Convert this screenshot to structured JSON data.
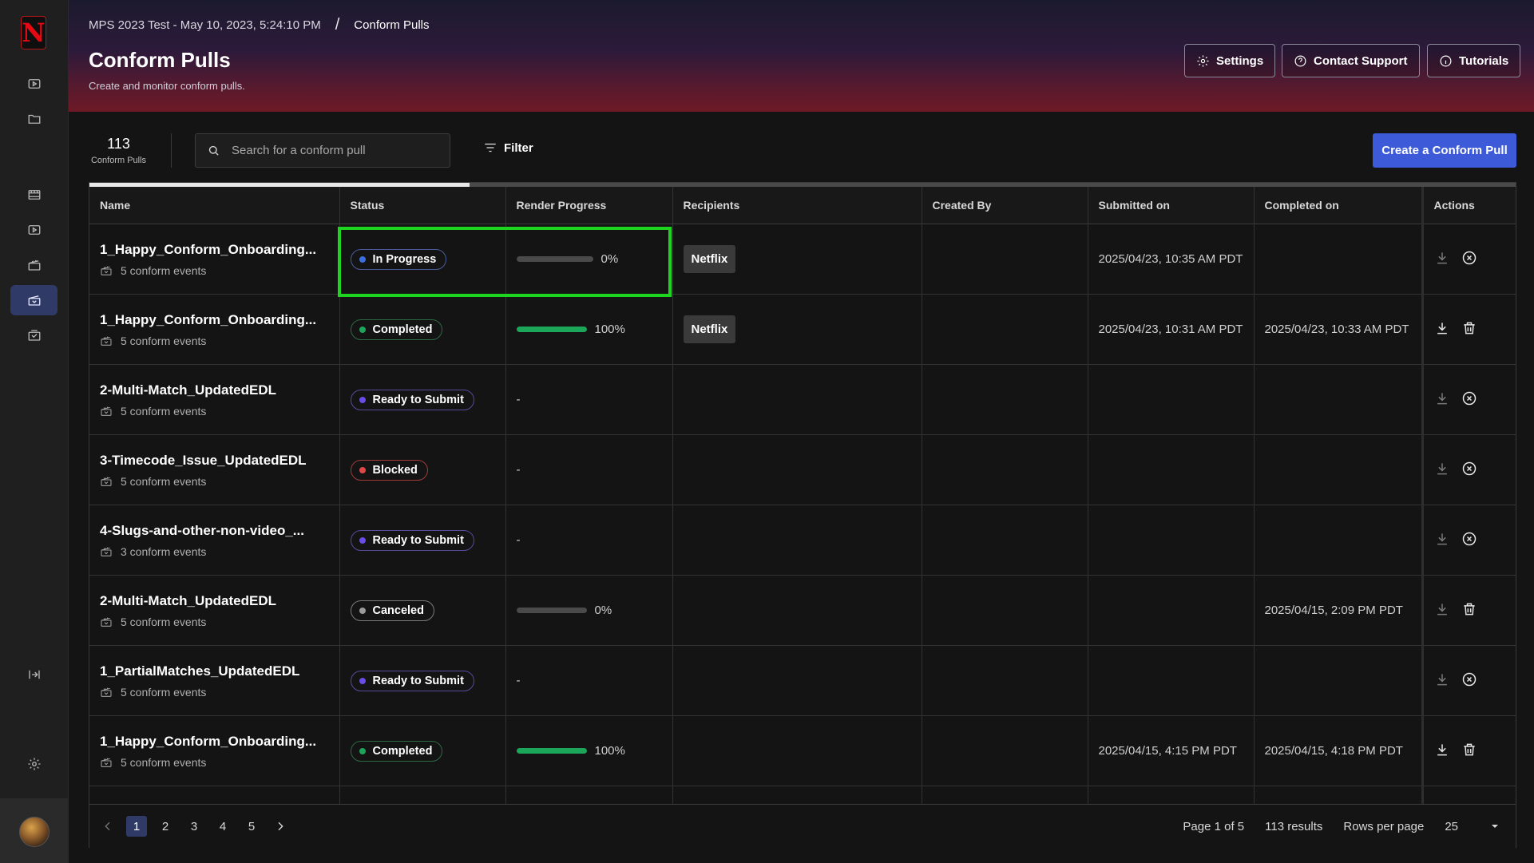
{
  "breadcrumb": {
    "parent": "MPS 2023 Test - May 10, 2023, 5:24:10 PM",
    "separator": "/",
    "current": "Conform Pulls"
  },
  "page": {
    "title": "Conform Pulls",
    "subtitle": "Create and monitor conform pulls."
  },
  "header_buttons": {
    "settings": "Settings",
    "support": "Contact Support",
    "tutorials": "Tutorials"
  },
  "toolbar": {
    "count": "113",
    "count_label": "Conform Pulls",
    "search_placeholder": "Search for a conform pull",
    "filter_label": "Filter",
    "create_label": "Create a Conform Pull"
  },
  "columns": [
    "Name",
    "Status",
    "Render Progress",
    "Recipients",
    "Created By",
    "Submitted on",
    "Completed on",
    "Actions"
  ],
  "rows": [
    {
      "name": "1_Happy_Conform_Onboarding...",
      "events": "5 conform events",
      "status": "In Progress",
      "progress_pct": 0,
      "progress_text": "0%",
      "recipient": "Netflix",
      "submitted": "2025/04/23, 10:35 AM PDT",
      "completed": ""
    },
    {
      "name": "1_Happy_Conform_Onboarding...",
      "events": "5 conform events",
      "status": "Completed",
      "progress_pct": 100,
      "progress_text": "100%",
      "recipient": "Netflix",
      "submitted": "2025/04/23, 10:31 AM PDT",
      "completed": "2025/04/23, 10:33 AM PDT"
    },
    {
      "name": "2-Multi-Match_UpdatedEDL",
      "events": "5 conform events",
      "status": "Ready to Submit",
      "progress_text": "-",
      "recipient": "",
      "submitted": "",
      "completed": ""
    },
    {
      "name": "3-Timecode_Issue_UpdatedEDL",
      "events": "5 conform events",
      "status": "Blocked",
      "progress_text": "-",
      "recipient": "",
      "submitted": "",
      "completed": ""
    },
    {
      "name": "4-Slugs-and-other-non-video_...",
      "events": "3 conform events",
      "status": "Ready to Submit",
      "progress_text": "-",
      "recipient": "",
      "submitted": "",
      "completed": ""
    },
    {
      "name": "2-Multi-Match_UpdatedEDL",
      "events": "5 conform events",
      "status": "Canceled",
      "progress_pct": 0,
      "progress_text": "0%",
      "recipient": "",
      "submitted": "",
      "completed": "2025/04/15, 2:09 PM PDT"
    },
    {
      "name": "1_PartialMatches_UpdatedEDL",
      "events": "5 conform events",
      "status": "Ready to Submit",
      "progress_text": "-",
      "recipient": "",
      "submitted": "",
      "completed": ""
    },
    {
      "name": "1_Happy_Conform_Onboarding...",
      "events": "5 conform events",
      "status": "Completed",
      "progress_pct": 100,
      "progress_text": "100%",
      "recipient": "",
      "submitted": "2025/04/15, 4:15 PM PDT",
      "completed": "2025/04/15, 4:18 PM PDT"
    }
  ],
  "status_colors": {
    "In Progress": "#3b6fe0",
    "Completed": "#1ca65a",
    "Ready to Submit": "#6a4ce6",
    "Blocked": "#e04848",
    "Canceled": "#9a9a9a"
  },
  "pagination": {
    "pages": [
      "1",
      "2",
      "3",
      "4",
      "5"
    ],
    "current_page": "1",
    "page_info": "Page 1 of 5",
    "results": "113 results",
    "rows_label": "Rows per page",
    "rows_value": "25"
  },
  "colors": {
    "accent": "#3d5bd9",
    "highlight": "#1fd41f"
  }
}
